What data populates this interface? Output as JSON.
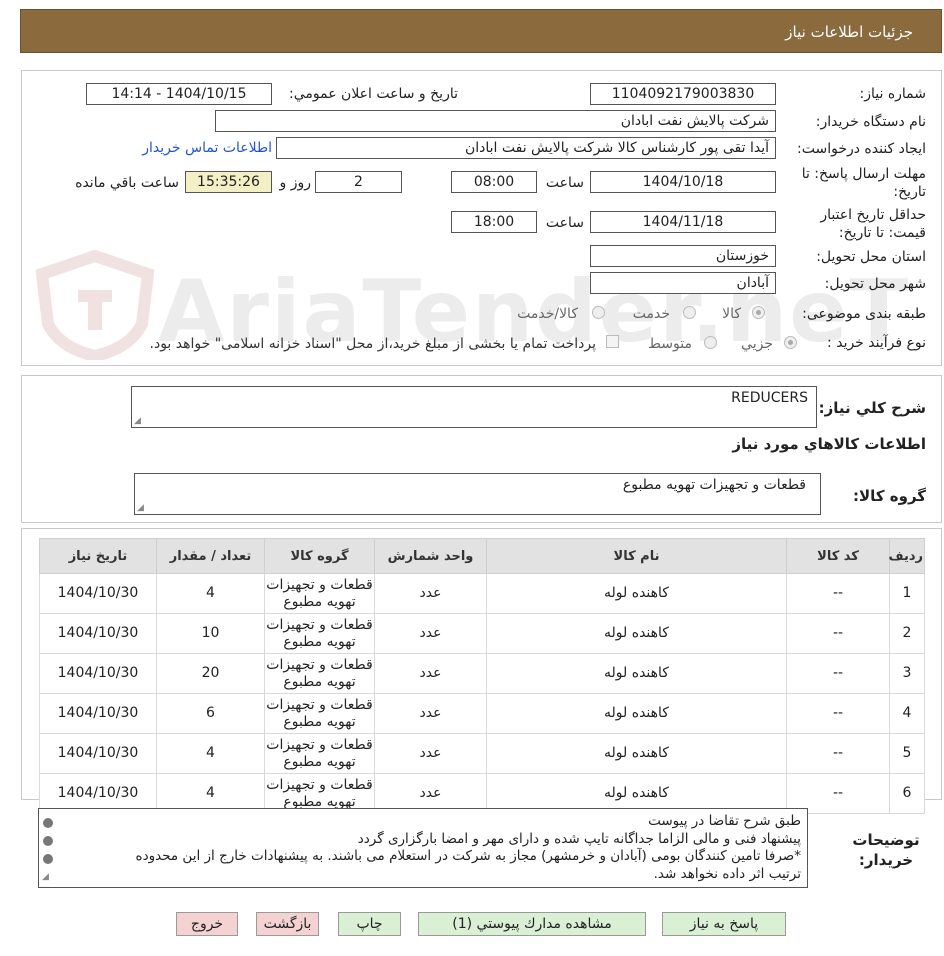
{
  "header": {
    "title": "جزئيات اطلاعات نياز"
  },
  "fields": {
    "need_number_label": "شماره نياز:",
    "need_number": "1104092179003830",
    "announce_label": "تاريخ و ساعت اعلان عمومي:",
    "announce_value": "1404/10/15 - 14:14",
    "buyer_org_label": "نام دستگاه خريدار:",
    "buyer_org": "شركت پالايش نفت ابادان",
    "requester_label": "ايجاد كننده درخواست:",
    "requester": "آيدا تقی پور كارشناس كالا شركت پالايش نفت ابادان",
    "contact_link": "اطلاعات تماس خريدار",
    "deadline_label": "مهلت ارسال پاسخ: تا تاريخ:",
    "deadline_date": "1404/10/18",
    "time_label": "ساعت",
    "deadline_time": "08:00",
    "days_value": "2",
    "days_label": "روز و",
    "remaining_time": "15:35:26",
    "remaining_label": "ساعت باقي مانده",
    "validity_label": "حداقل تاريخ اعتبار قيمت: تا تاريخ:",
    "validity_date": "1404/11/18",
    "validity_time": "18:00",
    "province_label": "استان محل تحويل:",
    "province": "خوزستان",
    "city_label": "شهر محل تحويل:",
    "city": "آبادان",
    "category_label": "طبقه بندی موضوعی:",
    "category_options": [
      "كالا",
      "خدمت",
      "كالا/خدمت"
    ],
    "process_label": "نوع فرآيند خريد :",
    "process_options": [
      "جزيي",
      "متوسط"
    ],
    "process_note": "پرداخت تمام يا بخشی از مبلغ خريد،از محل \"اسناد خزانه اسلامی\" خواهد بود."
  },
  "watermark": "AriaTender.neT",
  "summary": {
    "label": "شرح كلي نياز:",
    "value": "REDUCERS",
    "goods_title": "اطلاعات كالاهاي مورد نياز",
    "group_label": "گروه كالا:",
    "group_value": "قطعات و تجهيزات تهويه مطبوع"
  },
  "table": {
    "headers": [
      "رديف",
      "كد كالا",
      "نام كالا",
      "واحد شمارش",
      "گروه كالا",
      "تعداد / مقدار",
      "تاريخ نياز"
    ],
    "rows": [
      [
        "1",
        "--",
        "کاهنده لوله",
        "عدد",
        "قطعات و تجهيزات تهويه مطبوع",
        "4",
        "1404/10/30"
      ],
      [
        "2",
        "--",
        "کاهنده لوله",
        "عدد",
        "قطعات و تجهيزات تهويه مطبوع",
        "10",
        "1404/10/30"
      ],
      [
        "3",
        "--",
        "کاهنده لوله",
        "عدد",
        "قطعات و تجهيزات تهويه مطبوع",
        "20",
        "1404/10/30"
      ],
      [
        "4",
        "--",
        "کاهنده لوله",
        "عدد",
        "قطعات و تجهيزات تهويه مطبوع",
        "6",
        "1404/10/30"
      ],
      [
        "5",
        "--",
        "کاهنده لوله",
        "عدد",
        "قطعات و تجهيزات تهويه مطبوع",
        "4",
        "1404/10/30"
      ],
      [
        "6",
        "--",
        "کاهنده لوله",
        "عدد",
        "قطعات و تجهيزات تهويه مطبوع",
        "4",
        "1404/10/30"
      ]
    ]
  },
  "buyer_notes": {
    "label": "توضيحات خريدار:",
    "lines": [
      "طبق شرح تقاضا در پيوست",
      "پيشنهاد فنی و مالی الزاما جداگانه تايپ شده و دارای مهر و امضا بارگزاری گردد",
      "*صرفا تامين کنندگان بومی (آبادان و خرمشهر) مجاز به شرکت در استعلام می باشند. به پيشنهادات خارج از اين محدوده",
      "ترتيب اثر داده نخواهد شد."
    ]
  },
  "buttons": {
    "reply": "پاسخ به نياز",
    "attachments": "مشاهده مدارك پيوستي (1)",
    "print": "چاپ",
    "back": "بازگشت",
    "exit": "خروج"
  }
}
